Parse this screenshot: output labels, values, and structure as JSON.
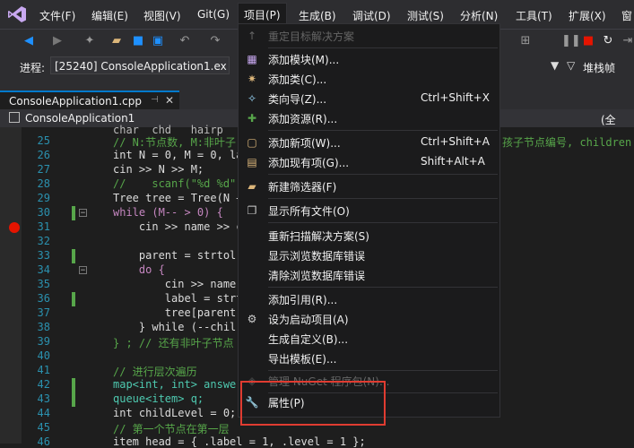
{
  "menubar": {
    "items": [
      {
        "label": "文件(F)"
      },
      {
        "label": "编辑(E)"
      },
      {
        "label": "视图(V)"
      },
      {
        "label": "Git(G)"
      },
      {
        "label": "项目(P)"
      },
      {
        "label": "生成(B)"
      },
      {
        "label": "调试(D)"
      },
      {
        "label": "测试(S)"
      },
      {
        "label": "分析(N)"
      },
      {
        "label": "工具(T)"
      },
      {
        "label": "扩展(X)"
      },
      {
        "label": "窗"
      }
    ]
  },
  "toolbar": {
    "process_label": "进程:",
    "process_value": "[25240] ConsoleApplication1.ex",
    "stack_label": "堆栈帧"
  },
  "tabs": {
    "file_tab": "ConsoleApplication1.cpp",
    "scope": "ConsoleApplication1",
    "scope_right": "(全"
  },
  "editor": {
    "lines": [
      {
        "n": "",
        "code": "char  chd   hairp"
      },
      {
        "n": "25",
        "code": "// N:节点数, M:非叶子"
      },
      {
        "n": "26",
        "code": "int N = 0, M = 0, la"
      },
      {
        "n": "27",
        "code": "cin >> N >> M;"
      },
      {
        "n": "28",
        "code": "//    scanf(\"%d %d\","
      },
      {
        "n": "29",
        "code": "Tree tree = Tree(N +"
      },
      {
        "n": "30",
        "code": "while (M-- > 0) {"
      },
      {
        "n": "31",
        "code": "    cin >> name >> c"
      },
      {
        "n": "32",
        "code": ""
      },
      {
        "n": "33",
        "code": "    parent = strtol("
      },
      {
        "n": "34",
        "code": "    do {"
      },
      {
        "n": "35",
        "code": "        cin >> name;"
      },
      {
        "n": "36",
        "code": "        label = strt"
      },
      {
        "n": "37",
        "code": "        tree[parent]"
      },
      {
        "n": "38",
        "code": "    } while (--chil"
      },
      {
        "n": "39",
        "code": "} ; // 还有非叶子节点"
      },
      {
        "n": "40",
        "code": ""
      },
      {
        "n": "41",
        "code": "// 进行层次遍历"
      },
      {
        "n": "42",
        "code": "map<int, int> answer"
      },
      {
        "n": "43",
        "code": "queue<item> q;"
      },
      {
        "n": "44",
        "code": "int childLevel = 0;"
      },
      {
        "n": "45",
        "code": "// 第一个节点在第一层"
      },
      {
        "n": "46",
        "code": "item head = { .label = 1, .level = 1 };"
      }
    ],
    "right_comment": "孩子节点编号, children"
  },
  "project_menu": {
    "items": [
      {
        "label": "重定目标解决方案",
        "shortcut": "",
        "icon": "arrow-up-icon",
        "disabled": true
      },
      {
        "label": "添加模块(M)...",
        "shortcut": "",
        "icon": "add-module-icon",
        "disabled": false
      },
      {
        "label": "添加类(C)...",
        "shortcut": "",
        "icon": "add-class-icon",
        "disabled": false
      },
      {
        "label": "类向导(Z)...",
        "shortcut": "Ctrl+Shift+X",
        "icon": "class-wizard-icon",
        "disabled": false
      },
      {
        "label": "添加资源(R)...",
        "shortcut": "",
        "icon": "add-resource-icon",
        "disabled": false
      },
      {
        "label": "添加新项(W)...",
        "shortcut": "Ctrl+Shift+A",
        "icon": "add-new-item-icon",
        "disabled": false
      },
      {
        "label": "添加现有项(G)...",
        "shortcut": "Shift+Alt+A",
        "icon": "add-existing-item-icon",
        "disabled": false
      },
      {
        "label": "新建筛选器(F)",
        "shortcut": "",
        "icon": "new-filter-icon",
        "disabled": false
      },
      {
        "label": "显示所有文件(O)",
        "shortcut": "",
        "icon": "show-all-files-icon",
        "disabled": false
      },
      {
        "label": "重新扫描解决方案(S)",
        "shortcut": "",
        "icon": "",
        "disabled": false
      },
      {
        "label": "显示浏览数据库错误",
        "shortcut": "",
        "icon": "",
        "disabled": false
      },
      {
        "label": "清除浏览数据库错误",
        "shortcut": "",
        "icon": "",
        "disabled": false
      },
      {
        "label": "添加引用(R)...",
        "shortcut": "",
        "icon": "",
        "disabled": false
      },
      {
        "label": "设为启动项目(A)",
        "shortcut": "",
        "icon": "gear-icon",
        "disabled": false
      },
      {
        "label": "生成自定义(B)...",
        "shortcut": "",
        "icon": "",
        "disabled": false
      },
      {
        "label": "导出模板(E)...",
        "shortcut": "",
        "icon": "",
        "disabled": false
      },
      {
        "label": "管理 NuGet 程序包(N)...",
        "shortcut": "",
        "icon": "nuget-icon",
        "disabled": true
      },
      {
        "label": "属性(P)",
        "shortcut": "",
        "icon": "wrench-icon",
        "disabled": false
      }
    ]
  },
  "colors": {
    "accent": "#007acc",
    "highlight_box": "#e03c31"
  }
}
